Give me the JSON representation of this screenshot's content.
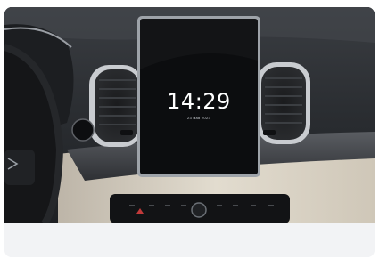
{
  "infotainment": {
    "time": "14:29",
    "date": "23 мая 2023"
  },
  "colors": {
    "dashboard": "#2b2e33",
    "trim": "#d8d2c6",
    "screen": "#0c0d0f",
    "footer": "#f2f3f5"
  }
}
